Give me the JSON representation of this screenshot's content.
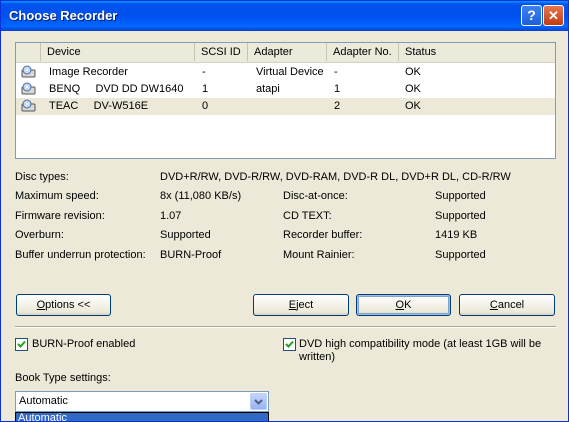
{
  "window": {
    "title": "Choose Recorder"
  },
  "recorder_list": {
    "columns": [
      "Device",
      "SCSI ID",
      "Adapter",
      "Adapter No.",
      "Status"
    ],
    "rows": [
      {
        "device": "Image Recorder",
        "scsi_id": "-",
        "adapter": "Virtual Device",
        "adapter_no": "-",
        "status": "OK"
      },
      {
        "device": "BENQ     DVD DD DW1640",
        "scsi_id": "1",
        "adapter": "atapi",
        "adapter_no": "1",
        "status": "OK"
      },
      {
        "device": "TEAC     DV-W516E",
        "scsi_id": "0",
        "adapter": "",
        "adapter_no": "2",
        "status": "OK"
      }
    ]
  },
  "details": {
    "disc_types_label": "Disc types:",
    "disc_types_value": "DVD+R/RW, DVD-R/RW, DVD-RAM, DVD-R DL, DVD+R DL, CD-R/RW",
    "max_speed_label": "Maximum speed:",
    "max_speed_value": "8x (11,080 KB/s)",
    "firmware_label": "Firmware revision:",
    "firmware_value": "1.07",
    "overburn_label": "Overburn:",
    "overburn_value": "Supported",
    "buffer_underrun_label": "Buffer underrun protection:",
    "buffer_underrun_value": "BURN-Proof",
    "dao_label": "Disc-at-once:",
    "dao_value": "Supported",
    "cdtext_label": "CD TEXT:",
    "cdtext_value": "Supported",
    "recorder_buffer_label": "Recorder buffer:",
    "recorder_buffer_value": "1419 KB",
    "mount_rainier_label": "Mount Rainier:",
    "mount_rainier_value": "Supported"
  },
  "buttons": {
    "options_pre": "",
    "options_key": "O",
    "options_post": "ptions <<",
    "eject_key": "E",
    "eject_post": "ject",
    "ok_key": "O",
    "ok_post": "K",
    "cancel_key": "C",
    "cancel_post": "ancel"
  },
  "options": {
    "burnproof_label": "BURN-Proof enabled",
    "burnproof_checked": true,
    "dvd_compat_label_line1": "DVD high compatibility mode (at least 1GB will be",
    "dvd_compat_label_line2": "written)",
    "dvd_compat_checked": true,
    "book_type_label": "Book Type settings:",
    "book_type_value": "Automatic",
    "book_type_dropdown_highlight": "Automatic"
  },
  "colors": {
    "titlebar": "#0053ee",
    "dialog_bg": "#ece9d8",
    "selection": "#316ac5",
    "checkmark": "#21a121"
  }
}
